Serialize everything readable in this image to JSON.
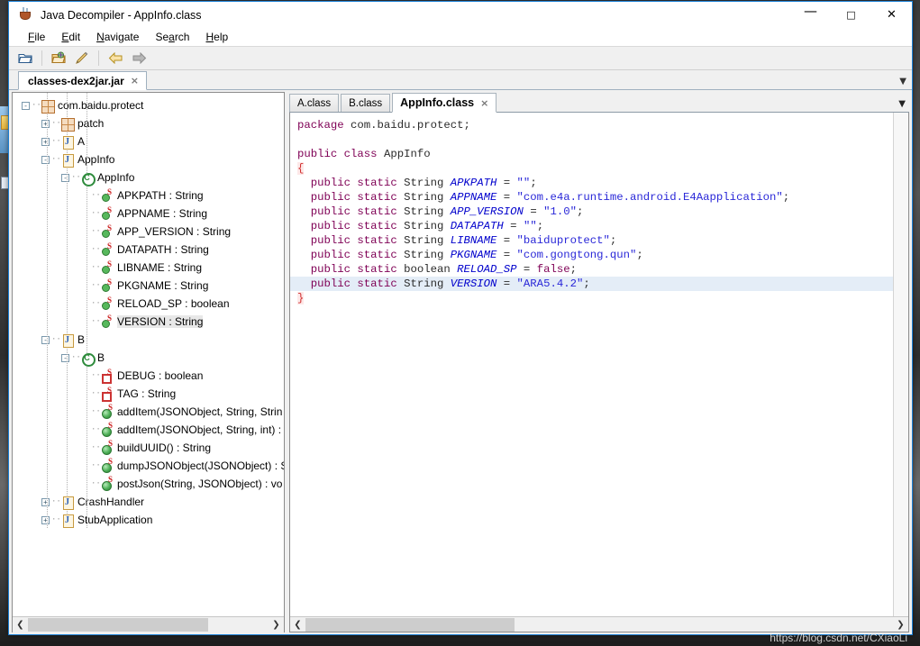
{
  "window": {
    "title": "Java Decompiler - AppInfo.class",
    "app_icon": "coffee-cup-icon",
    "minimize_label": "—",
    "maximize_label": "□",
    "close_label": "✕"
  },
  "menubar": [
    {
      "label": "File",
      "mnemonic": "F"
    },
    {
      "label": "Edit",
      "mnemonic": "E"
    },
    {
      "label": "Navigate",
      "mnemonic": "N"
    },
    {
      "label": "Search",
      "mnemonic": "a"
    },
    {
      "label": "Help",
      "mnemonic": "H"
    }
  ],
  "toolbar": [
    {
      "name": "open-file-button",
      "icon": "open-folder-icon"
    },
    {
      "name": "open-package-button",
      "icon": "package-folder-icon"
    },
    {
      "name": "save-sources-button",
      "icon": "pin-pencil-icon"
    },
    {
      "name": "navigate-back-button",
      "icon": "arrow-left-icon"
    },
    {
      "name": "navigate-forward-button",
      "icon": "arrow-right-icon"
    }
  ],
  "jar_tabs": [
    {
      "label": "classes-dex2jar.jar",
      "active": true,
      "close": "×"
    }
  ],
  "jar_strip_dropdown": "▼",
  "tree": [
    {
      "depth": 0,
      "expander": "-",
      "icon": "package-icon",
      "label": "com.baidu.protect",
      "selected": false
    },
    {
      "depth": 1,
      "expander": "+",
      "icon": "package-icon",
      "label": "patch",
      "selected": false
    },
    {
      "depth": 1,
      "expander": "+",
      "icon": "class-icon",
      "label": "A",
      "selected": false
    },
    {
      "depth": 1,
      "expander": "-",
      "icon": "class-icon",
      "label": "AppInfo",
      "selected": false
    },
    {
      "depth": 2,
      "expander": "-",
      "icon": "constructor-icon",
      "label": "AppInfo",
      "selected": false
    },
    {
      "depth": 3,
      "expander": "",
      "icon": "static-field-icon",
      "label": "APKPATH : String",
      "selected": false
    },
    {
      "depth": 3,
      "expander": "",
      "icon": "static-field-icon",
      "label": "APPNAME : String",
      "selected": false
    },
    {
      "depth": 3,
      "expander": "",
      "icon": "static-field-icon",
      "label": "APP_VERSION : String",
      "selected": false
    },
    {
      "depth": 3,
      "expander": "",
      "icon": "static-field-icon",
      "label": "DATAPATH : String",
      "selected": false
    },
    {
      "depth": 3,
      "expander": "",
      "icon": "static-field-icon",
      "label": "LIBNAME : String",
      "selected": false
    },
    {
      "depth": 3,
      "expander": "",
      "icon": "static-field-icon",
      "label": "PKGNAME : String",
      "selected": false
    },
    {
      "depth": 3,
      "expander": "",
      "icon": "static-field-icon",
      "label": "RELOAD_SP : boolean",
      "selected": false
    },
    {
      "depth": 3,
      "expander": "",
      "icon": "static-field-icon",
      "label": "VERSION : String",
      "selected": true
    },
    {
      "depth": 1,
      "expander": "-",
      "icon": "class-icon",
      "label": "B",
      "selected": false
    },
    {
      "depth": 2,
      "expander": "-",
      "icon": "constructor-icon",
      "label": "B",
      "selected": false
    },
    {
      "depth": 3,
      "expander": "",
      "icon": "private-field-icon",
      "label": "DEBUG : boolean",
      "selected": false
    },
    {
      "depth": 3,
      "expander": "",
      "icon": "private-field-icon",
      "label": "TAG : String",
      "selected": false
    },
    {
      "depth": 3,
      "expander": "",
      "icon": "method-icon",
      "label": "addItem(JSONObject, String, Strin",
      "selected": false
    },
    {
      "depth": 3,
      "expander": "",
      "icon": "method-icon",
      "label": "addItem(JSONObject, String, int) :",
      "selected": false
    },
    {
      "depth": 3,
      "expander": "",
      "icon": "method-icon",
      "label": "buildUUID() : String",
      "selected": false
    },
    {
      "depth": 3,
      "expander": "",
      "icon": "method-icon",
      "label": "dumpJSONObject(JSONObject) : S",
      "selected": false
    },
    {
      "depth": 3,
      "expander": "",
      "icon": "method-icon",
      "label": "postJson(String, JSONObject) : vo",
      "selected": false
    },
    {
      "depth": 1,
      "expander": "+",
      "icon": "class-icon",
      "label": "CrashHandler",
      "selected": false
    },
    {
      "depth": 1,
      "expander": "+",
      "icon": "class-icon",
      "label": "StubApplication",
      "selected": false
    }
  ],
  "code_tabs": [
    {
      "label": "A.class",
      "active": false
    },
    {
      "label": "B.class",
      "active": false
    },
    {
      "label": "AppInfo.class",
      "active": true,
      "close": "×"
    }
  ],
  "code_tab_dropdown": "▼",
  "code_lines": [
    {
      "highlight": false,
      "tokens": [
        {
          "t": "kw",
          "v": "package"
        },
        {
          "t": "pln",
          "v": " com.baidu.protect;"
        }
      ]
    },
    {
      "highlight": false,
      "tokens": []
    },
    {
      "highlight": false,
      "tokens": [
        {
          "t": "kw",
          "v": "public class"
        },
        {
          "t": "pln",
          "v": " AppInfo"
        }
      ]
    },
    {
      "highlight": false,
      "tokens": [
        {
          "t": "brace",
          "v": "{"
        }
      ]
    },
    {
      "highlight": false,
      "tokens": [
        {
          "t": "pln",
          "v": "  "
        },
        {
          "t": "kw",
          "v": "public static"
        },
        {
          "t": "pln",
          "v": " String "
        },
        {
          "t": "fld",
          "v": "APKPATH"
        },
        {
          "t": "pln",
          "v": " = "
        },
        {
          "t": "str",
          "v": "\"\""
        },
        {
          "t": "pln",
          "v": ";"
        }
      ]
    },
    {
      "highlight": false,
      "tokens": [
        {
          "t": "pln",
          "v": "  "
        },
        {
          "t": "kw",
          "v": "public static"
        },
        {
          "t": "pln",
          "v": " String "
        },
        {
          "t": "fld",
          "v": "APPNAME"
        },
        {
          "t": "pln",
          "v": " = "
        },
        {
          "t": "str",
          "v": "\"com.e4a.runtime.android.E4Aapplication\""
        },
        {
          "t": "pln",
          "v": ";"
        }
      ]
    },
    {
      "highlight": false,
      "tokens": [
        {
          "t": "pln",
          "v": "  "
        },
        {
          "t": "kw",
          "v": "public static"
        },
        {
          "t": "pln",
          "v": " String "
        },
        {
          "t": "fld",
          "v": "APP_VERSION"
        },
        {
          "t": "pln",
          "v": " = "
        },
        {
          "t": "str",
          "v": "\"1.0\""
        },
        {
          "t": "pln",
          "v": ";"
        }
      ]
    },
    {
      "highlight": false,
      "tokens": [
        {
          "t": "pln",
          "v": "  "
        },
        {
          "t": "kw",
          "v": "public static"
        },
        {
          "t": "pln",
          "v": " String "
        },
        {
          "t": "fld",
          "v": "DATAPATH"
        },
        {
          "t": "pln",
          "v": " = "
        },
        {
          "t": "str",
          "v": "\"\""
        },
        {
          "t": "pln",
          "v": ";"
        }
      ]
    },
    {
      "highlight": false,
      "tokens": [
        {
          "t": "pln",
          "v": "  "
        },
        {
          "t": "kw",
          "v": "public static"
        },
        {
          "t": "pln",
          "v": " String "
        },
        {
          "t": "fld",
          "v": "LIBNAME"
        },
        {
          "t": "pln",
          "v": " = "
        },
        {
          "t": "str",
          "v": "\"baiduprotect\""
        },
        {
          "t": "pln",
          "v": ";"
        }
      ]
    },
    {
      "highlight": false,
      "tokens": [
        {
          "t": "pln",
          "v": "  "
        },
        {
          "t": "kw",
          "v": "public static"
        },
        {
          "t": "pln",
          "v": " String "
        },
        {
          "t": "fld",
          "v": "PKGNAME"
        },
        {
          "t": "pln",
          "v": " = "
        },
        {
          "t": "str",
          "v": "\"com.gongtong.qun\""
        },
        {
          "t": "pln",
          "v": ";"
        }
      ]
    },
    {
      "highlight": false,
      "tokens": [
        {
          "t": "pln",
          "v": "  "
        },
        {
          "t": "kw",
          "v": "public static"
        },
        {
          "t": "pln",
          "v": " boolean "
        },
        {
          "t": "fld",
          "v": "RELOAD_SP"
        },
        {
          "t": "pln",
          "v": " = "
        },
        {
          "t": "kw",
          "v": "false"
        },
        {
          "t": "pln",
          "v": ";"
        }
      ]
    },
    {
      "highlight": true,
      "tokens": [
        {
          "t": "pln",
          "v": "  "
        },
        {
          "t": "kw",
          "v": "public static"
        },
        {
          "t": "pln",
          "v": " String "
        },
        {
          "t": "fld",
          "v": "VERSION"
        },
        {
          "t": "pln",
          "v": " = "
        },
        {
          "t": "str",
          "v": "\"ARA5.4.2\""
        },
        {
          "t": "pln",
          "v": ";"
        }
      ]
    },
    {
      "highlight": false,
      "tokens": [
        {
          "t": "brace",
          "v": "}"
        }
      ]
    }
  ],
  "scrollbars": {
    "left_arrow": "❮",
    "right_arrow": "❯"
  },
  "watermark": "https://blog.csdn.net/CXiaoLi"
}
